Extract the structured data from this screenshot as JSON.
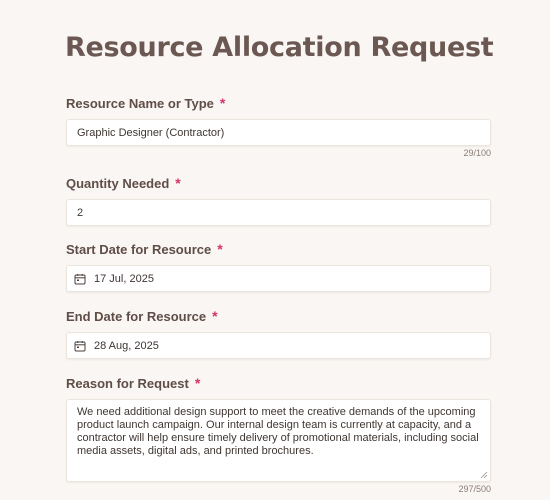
{
  "form": {
    "title": "Resource Allocation Request",
    "required_mark": "*",
    "fields": {
      "resource_name": {
        "label": "Resource Name or Type",
        "value": "Graphic Designer (Contractor)",
        "counter": "29/100"
      },
      "quantity": {
        "label": "Quantity Needed",
        "value": "2"
      },
      "start_date": {
        "label": "Start Date for Resource",
        "value": "17 Jul, 2025",
        "icon": "calendar-icon"
      },
      "end_date": {
        "label": "End Date for Resource",
        "value": "28 Aug, 2025",
        "icon": "calendar-icon"
      },
      "reason": {
        "label": "Reason for Request",
        "value": "We need additional design support to meet the creative demands of the upcoming product launch campaign. Our internal design team is currently at capacity, and a contractor will help ensure timely delivery of promotional materials, including social media assets, digital ads, and printed brochures.",
        "counter": "297/500"
      }
    },
    "colors": {
      "background": "#faf6f3",
      "title": "#6b5852",
      "required": "#d6336c"
    }
  }
}
